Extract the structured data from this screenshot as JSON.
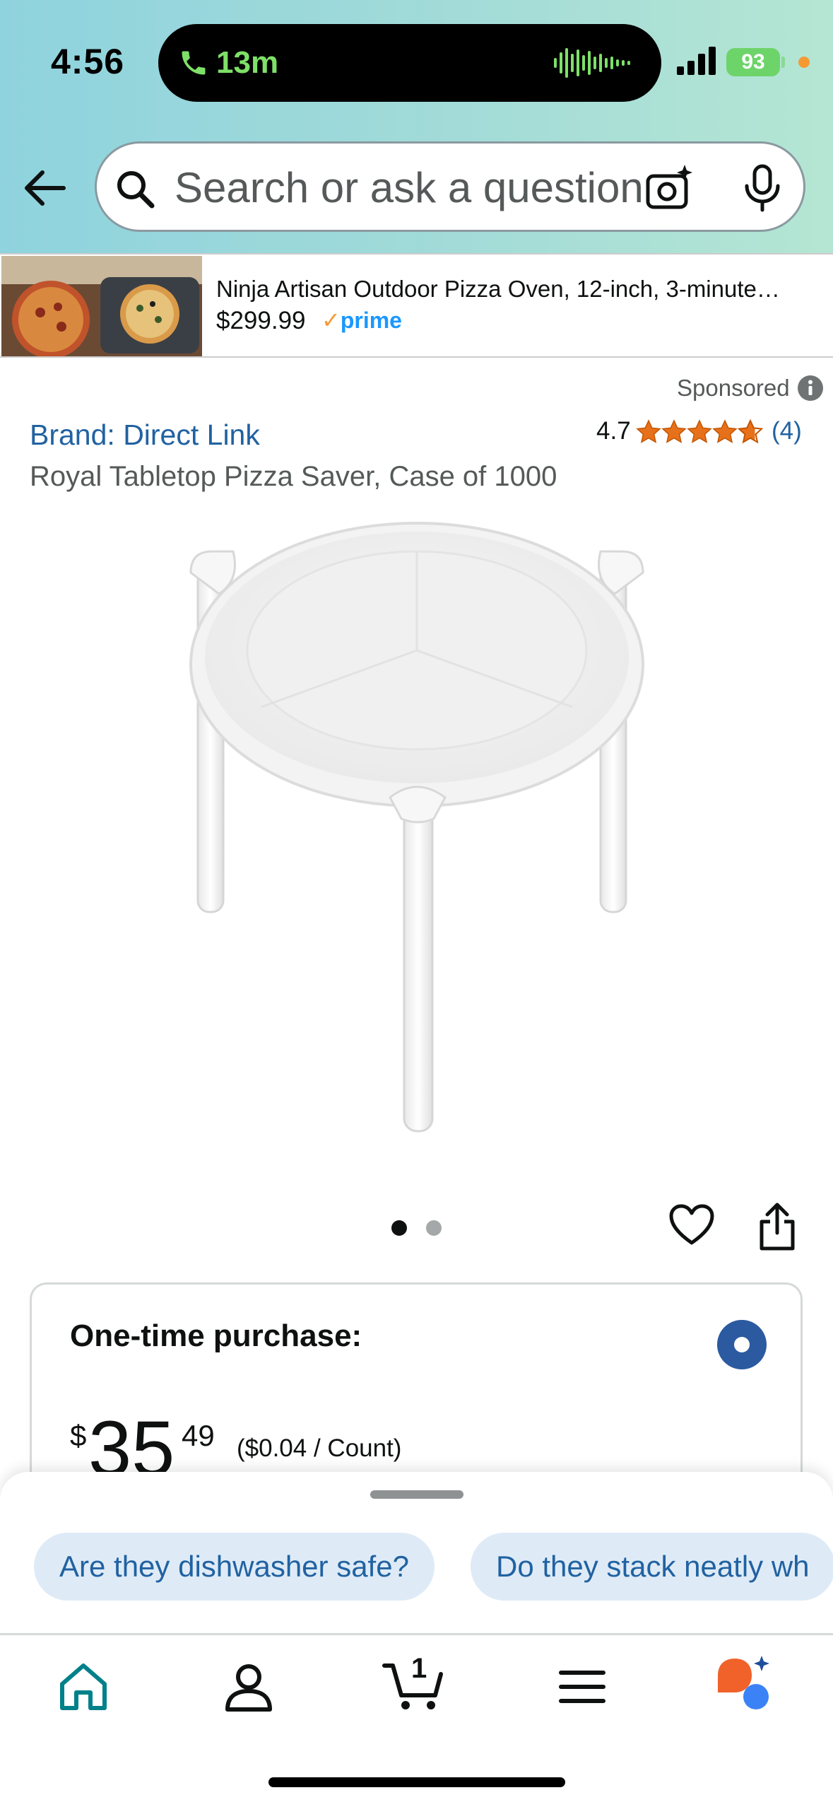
{
  "status_bar": {
    "time": "4:56",
    "call_duration": "13m",
    "battery": "93"
  },
  "search": {
    "placeholder": "Search or ask a question"
  },
  "sponsored_banner": {
    "title": "Ninja Artisan Outdoor Pizza Oven, 12-inch, 3-minute…",
    "price": "$299.99",
    "prime_check": "✓",
    "prime_label": "prime"
  },
  "product": {
    "sponsored_label": "Sponsored",
    "brand": "Brand: Direct Link",
    "rating": "4.7",
    "rating_value": 4.7,
    "rating_count": "(4)",
    "title": "Royal Tabletop Pizza Saver, Case of 1000",
    "image_count": 2,
    "current_image": 1
  },
  "purchase": {
    "label": "One-time purchase:",
    "currency": "$",
    "price_whole": "35",
    "price_fraction": "49",
    "unit_price": "($0.04 / Count)",
    "selected": true
  },
  "suggestions": [
    "Are they dishwasher safe?",
    "Do they stack neatly wh"
  ],
  "bottom_nav": {
    "items": [
      "home-icon",
      "account-icon",
      "cart-icon",
      "menu-icon",
      "rufus-icon"
    ],
    "cart_count": "1",
    "active": "home"
  },
  "colors": {
    "link": "#2162a1",
    "chip_bg": "#deebf7",
    "radio": "#2b5aa0",
    "star": "#e7711b",
    "home_active": "#00818a"
  }
}
